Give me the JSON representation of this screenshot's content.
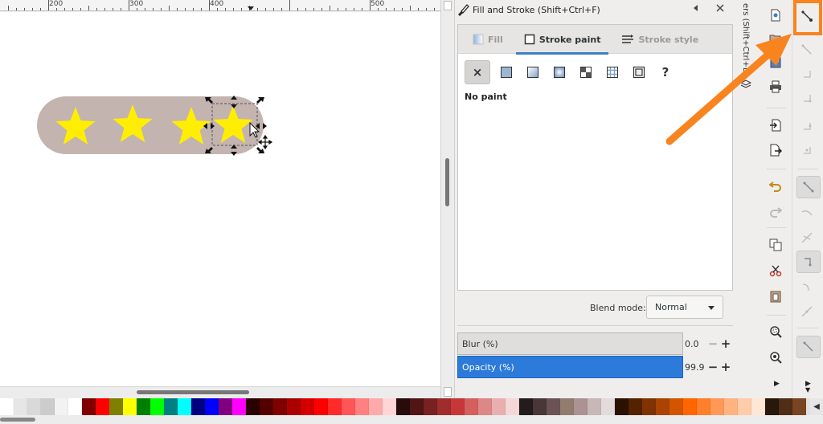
{
  "ruler": {
    "labels": [
      "200",
      "300",
      "400",
      "500"
    ]
  },
  "dialog": {
    "title": "Fill and Stroke (Shift+Ctrl+F)",
    "tabs": [
      {
        "label": "Fill",
        "active": false
      },
      {
        "label": "Stroke paint",
        "active": true
      },
      {
        "label": "Stroke style",
        "active": false
      }
    ],
    "paint_modes": [
      "no-paint",
      "flat-color",
      "linear-gradient",
      "radial-gradient",
      "pattern",
      "swatch",
      "mesh",
      "unset"
    ],
    "unset_symbol": "?",
    "no_paint_symbol": "×",
    "status_text": "No paint",
    "blend_label": "Blend mode:",
    "blend_value": "Normal",
    "blur_label": "Blur (%)",
    "blur_value": "0.0",
    "opacity_label": "Opacity (%)",
    "opacity_value": "99.9",
    "minus": "−",
    "plus": "+",
    "opacity_level": 0.999
  },
  "side_label": "ers (Shift+Ctrl+L)",
  "canvas": {
    "pill_color": "#c4b4b0",
    "star_color": "#ffee00",
    "star_count": 4
  },
  "accent": "#f7841f",
  "palette": [
    "#ffffff",
    "#e6e6e6",
    "#d9d9d9",
    "#cccccc",
    "#f2f2f2",
    "#ffffff",
    "#800000",
    "#ff0000",
    "#808000",
    "#ffff00",
    "#008000",
    "#00ff00",
    "#008080",
    "#00ffff",
    "#000080",
    "#0000ff",
    "#800080",
    "#ff00ff",
    "#2b0000",
    "#550000",
    "#800000",
    "#aa0000",
    "#d40000",
    "#ff0000",
    "#ff2a2a",
    "#ff5555",
    "#ff8080",
    "#ffaaaa",
    "#ffd5d5",
    "#280b0b",
    "#501616",
    "#782121",
    "#a02c2c",
    "#c83737",
    "#d35f5f",
    "#de8787",
    "#e9afaf",
    "#f4d7d7",
    "#241c1c",
    "#483737",
    "#6c5353",
    "#917c6f",
    "#ac9393",
    "#c8b7b7",
    "#e3dbdb",
    "#2b1100",
    "#552200",
    "#803300",
    "#aa4400",
    "#d45500",
    "#ff6600",
    "#ff7f2a",
    "#ff9955",
    "#ffb380",
    "#ffccaa",
    "#ffe6d5",
    "#28170b",
    "#502d16",
    "#784421",
    "#a05a2c",
    "#c87137",
    "#d38d5f",
    "#deaa87"
  ]
}
